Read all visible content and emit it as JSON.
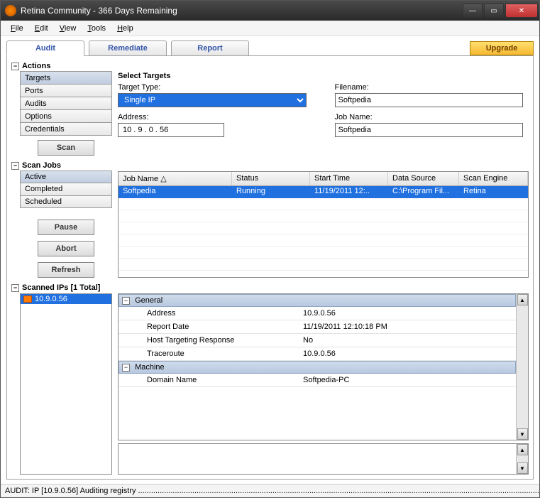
{
  "window": {
    "title": "Retina Community - 366  Days Remaining"
  },
  "menu": {
    "file": "File",
    "edit": "Edit",
    "view": "View",
    "tools": "Tools",
    "help": "Help"
  },
  "tabs": {
    "audit": "Audit",
    "remediate": "Remediate",
    "report": "Report",
    "upgrade": "Upgrade"
  },
  "sections": {
    "actions": "Actions",
    "scanjobs": "Scan Jobs",
    "scannedips": "Scanned IPs [1 Total]"
  },
  "actions": {
    "items": [
      "Targets",
      "Ports",
      "Audits",
      "Options",
      "Credentials"
    ],
    "scan": "Scan"
  },
  "form": {
    "title": "Select Targets",
    "target_type_label": "Target Type:",
    "target_type": "Single IP",
    "address_label": "Address:",
    "address": "10 .  9  .  0  .  56",
    "filename_label": "Filename:",
    "filename": "Softpedia",
    "jobname_label": "Job Name:",
    "jobname": "Softpedia"
  },
  "scanjobs": {
    "items": [
      "Active",
      "Completed",
      "Scheduled"
    ],
    "buttons": {
      "pause": "Pause",
      "abort": "Abort",
      "refresh": "Refresh"
    },
    "columns": [
      "Job Name",
      "Status",
      "Start Time",
      "Data Source",
      "Scan Engine"
    ],
    "rows": [
      {
        "name": "Softpedia",
        "status": "Running",
        "start": "11/19/2011 12:..",
        "source": "C:\\Program Fil...",
        "engine": "Retina"
      }
    ]
  },
  "ips": {
    "items": [
      "10.9.0.56"
    ]
  },
  "details": {
    "groups": [
      {
        "name": "General",
        "rows": [
          {
            "k": "Address",
            "v": "10.9.0.56"
          },
          {
            "k": "Report Date",
            "v": "11/19/2011 12:10:18 PM"
          },
          {
            "k": "Host Targeting Response",
            "v": "No"
          },
          {
            "k": "Traceroute",
            "v": "10.9.0.56"
          }
        ]
      },
      {
        "name": "Machine",
        "rows": [
          {
            "k": "Domain Name",
            "v": "Softpedia-PC"
          }
        ]
      }
    ]
  },
  "status": "AUDIT: IP [10.9.0.56] Auditing registry ...................................................................................................................................................................................................................................................."
}
